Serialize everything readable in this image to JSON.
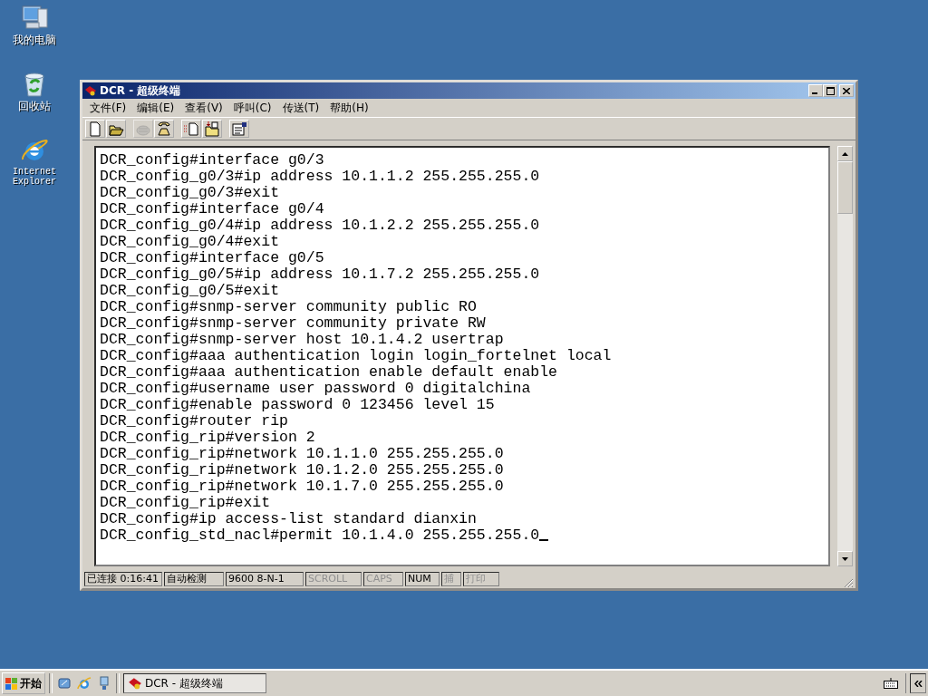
{
  "desktop_icons": [
    {
      "kind": "computer",
      "label": "我的电脑"
    },
    {
      "kind": "recycle",
      "label": "回收站"
    },
    {
      "kind": "ie",
      "label": "Internet Explorer"
    }
  ],
  "window": {
    "title": "DCR - 超级终端"
  },
  "menu": [
    "文件(F)",
    "编辑(E)",
    "查看(V)",
    "呼叫(C)",
    "传送(T)",
    "帮助(H)"
  ],
  "toolbar": [
    [
      {
        "kind": "new",
        "disabled": false
      },
      {
        "kind": "open",
        "disabled": false
      }
    ],
    [
      {
        "kind": "phone",
        "disabled": true
      },
      {
        "kind": "handset",
        "disabled": false
      }
    ],
    [
      {
        "kind": "send",
        "disabled": false
      },
      {
        "kind": "receive",
        "disabled": false
      }
    ],
    [
      {
        "kind": "properties",
        "disabled": false
      }
    ]
  ],
  "terminal_lines": [
    "DCR_config#interface g0/3",
    "DCR_config_g0/3#ip address 10.1.1.2 255.255.255.0",
    "DCR_config_g0/3#exit",
    "DCR_config#interface g0/4",
    "DCR_config_g0/4#ip address 10.1.2.2 255.255.255.0",
    "DCR_config_g0/4#exit",
    "DCR_config#interface g0/5",
    "DCR_config_g0/5#ip address 10.1.7.2 255.255.255.0",
    "DCR_config_g0/5#exit",
    "DCR_config#snmp-server community public RO",
    "DCR_config#snmp-server community private RW",
    "DCR_config#snmp-server host 10.1.4.2 usertrap",
    "DCR_config#aaa authentication login login_fortelnet local",
    "DCR_config#aaa authentication enable default enable",
    "DCR_config#username user password 0 digitalchina",
    "DCR_config#enable password 0 123456 level 15",
    "DCR_config#router rip",
    "DCR_config_rip#version 2",
    "DCR_config_rip#network 10.1.1.0 255.255.255.0",
    "DCR_config_rip#network 10.1.2.0 255.255.255.0",
    "DCR_config_rip#network 10.1.7.0 255.255.255.0",
    "DCR_config_rip#exit",
    "DCR_config#ip access-list standard dianxin",
    "DCR_config_std_nacl#permit 10.1.4.0 255.255.255.0"
  ],
  "status_bar": [
    {
      "text": "已连接 0:16:41",
      "disabled": false
    },
    {
      "text": "自动检测",
      "disabled": false
    },
    {
      "text": "9600 8-N-1",
      "disabled": false
    },
    {
      "text": "SCROLL",
      "disabled": true
    },
    {
      "text": "CAPS",
      "disabled": true
    },
    {
      "text": "NUM",
      "disabled": false
    },
    {
      "text": "捕",
      "disabled": true
    },
    {
      "text": "打印",
      "disabled": true
    }
  ],
  "taskbar": {
    "start": "开始",
    "tasks": [
      {
        "label": "DCR - 超级终端",
        "selected": true
      }
    ]
  }
}
